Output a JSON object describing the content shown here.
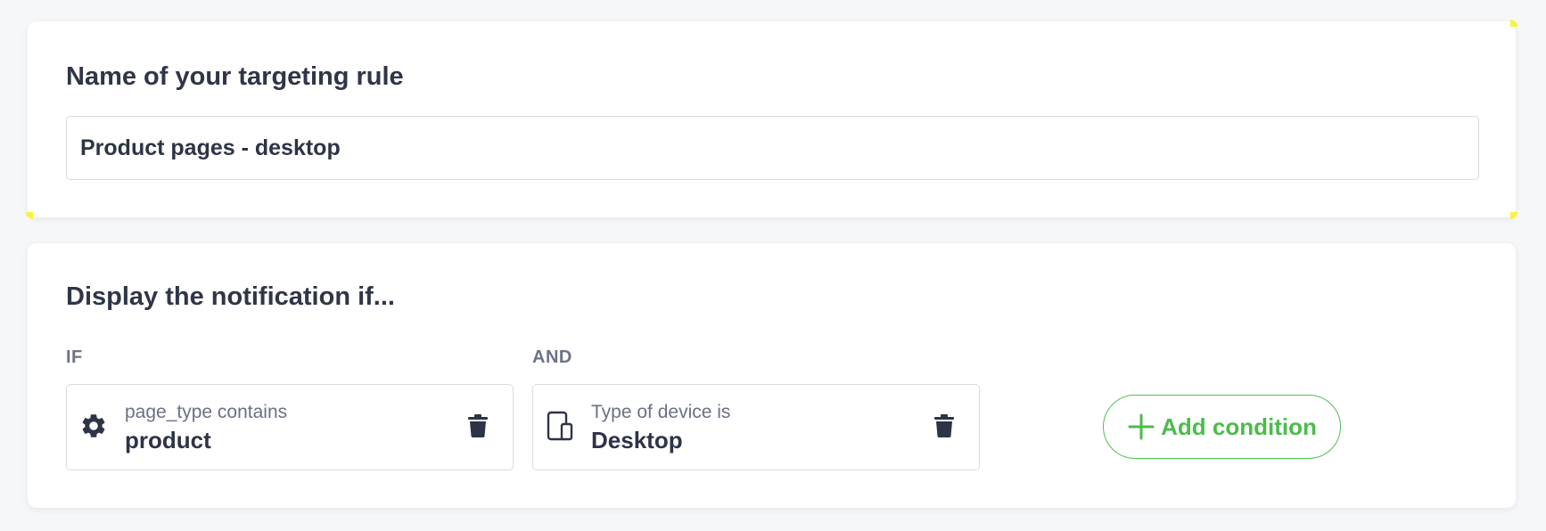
{
  "name_section": {
    "title": "Name of your targeting rule",
    "input_value": "Product pages - desktop"
  },
  "conditions_section": {
    "title": "Display the notification if...",
    "if_label": "IF",
    "and_label": "AND",
    "conditions": [
      {
        "icon": "gear-icon",
        "subtitle": "page_type contains",
        "value": "product"
      },
      {
        "icon": "devices-icon",
        "subtitle": "Type of device is",
        "value": "Desktop"
      }
    ],
    "add_button_label": "Add condition"
  },
  "colors": {
    "accent_green": "#4cbb4c",
    "highlight_yellow": "#f6f346",
    "text_dark": "#2e3447"
  }
}
